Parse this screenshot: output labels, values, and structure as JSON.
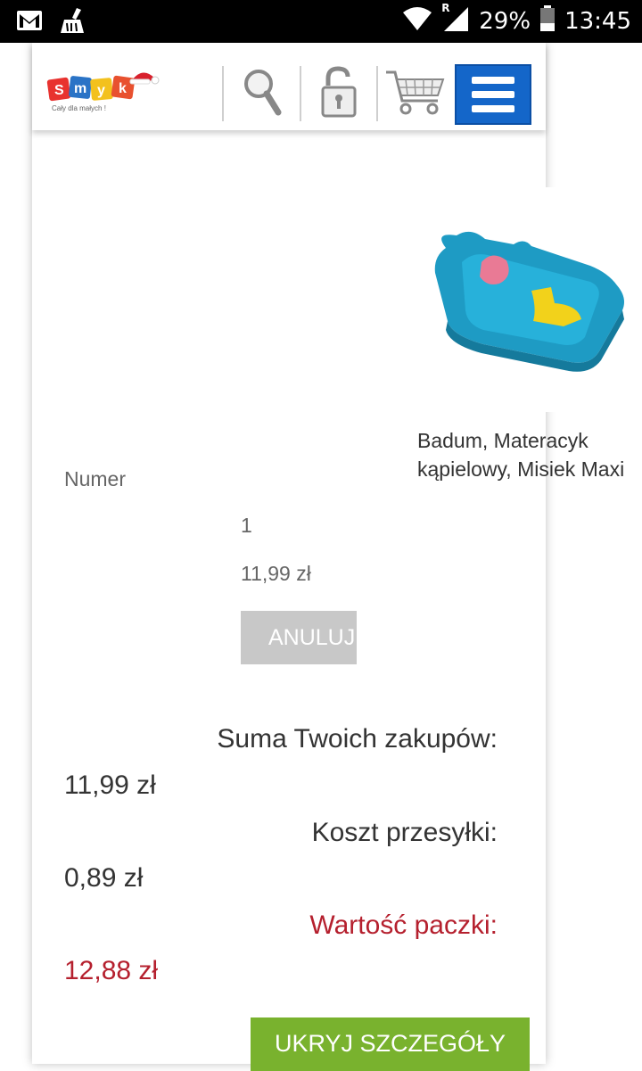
{
  "status_bar": {
    "battery": "29%",
    "time": "13:45",
    "roaming": "R",
    "icons": [
      "gmail-icon",
      "cleaner-icon",
      "wifi-icon",
      "signal-icon",
      "battery-icon"
    ]
  },
  "header": {
    "logo_alt": "Smyk",
    "logo_tagline": "Cały dla małych !",
    "icons": [
      "search-icon",
      "lock-icon",
      "cart-icon",
      "menu-icon"
    ],
    "accent_color": "#1466c9"
  },
  "cart_item": {
    "product_name": "Badum, Materacyk kąpielowy, Misiek Maxi",
    "number_label": "Numer",
    "quantity": "1",
    "price": "11,99 zł",
    "cancel_label": "ANULUJ"
  },
  "summary": {
    "subtotal_label": "Suma Twoich zakupów:",
    "subtotal_value": "11,99 zł",
    "shipping_label": "Koszt przesyłki:",
    "shipping_value": "0,89 zł",
    "total_label": "Wartość paczki:",
    "total_value": "12,88 zł",
    "total_color": "#b5202e"
  },
  "details_button": {
    "label": "UKRYJ SZCZEGÓŁY",
    "color": "#79b22e"
  }
}
